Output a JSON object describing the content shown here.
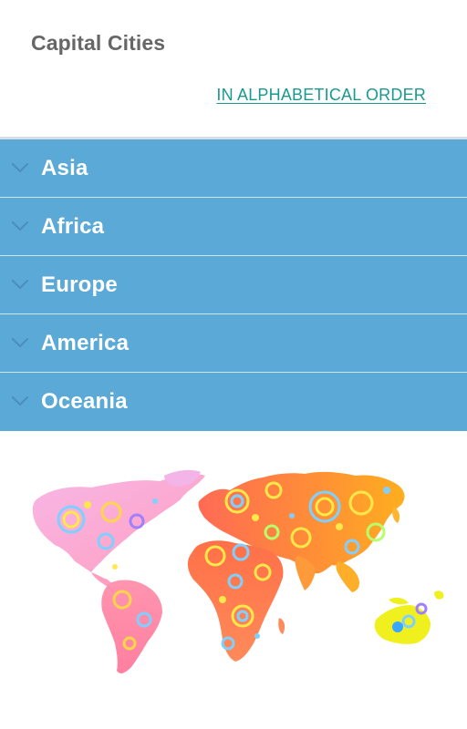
{
  "app": {
    "title": "Capital Cities",
    "order_link": "IN ALPHABETICAL ORDER"
  },
  "regions": [
    {
      "label": "Asia",
      "icon": "chevron-down-icon"
    },
    {
      "label": "Africa",
      "icon": "chevron-down-icon"
    },
    {
      "label": "Europe",
      "icon": "chevron-down-icon"
    },
    {
      "label": "America",
      "icon": "chevron-down-icon"
    },
    {
      "label": "Oceania",
      "icon": "chevron-down-icon"
    }
  ],
  "colors": {
    "header_bg": "#ffffff",
    "title": "#666666",
    "link": "#1a9a8f",
    "region_bg": "#5ba9d6",
    "region_text": "#ffffff",
    "chevron": "#4a8fbf"
  },
  "illustration": {
    "name": "world-map-illustration"
  }
}
